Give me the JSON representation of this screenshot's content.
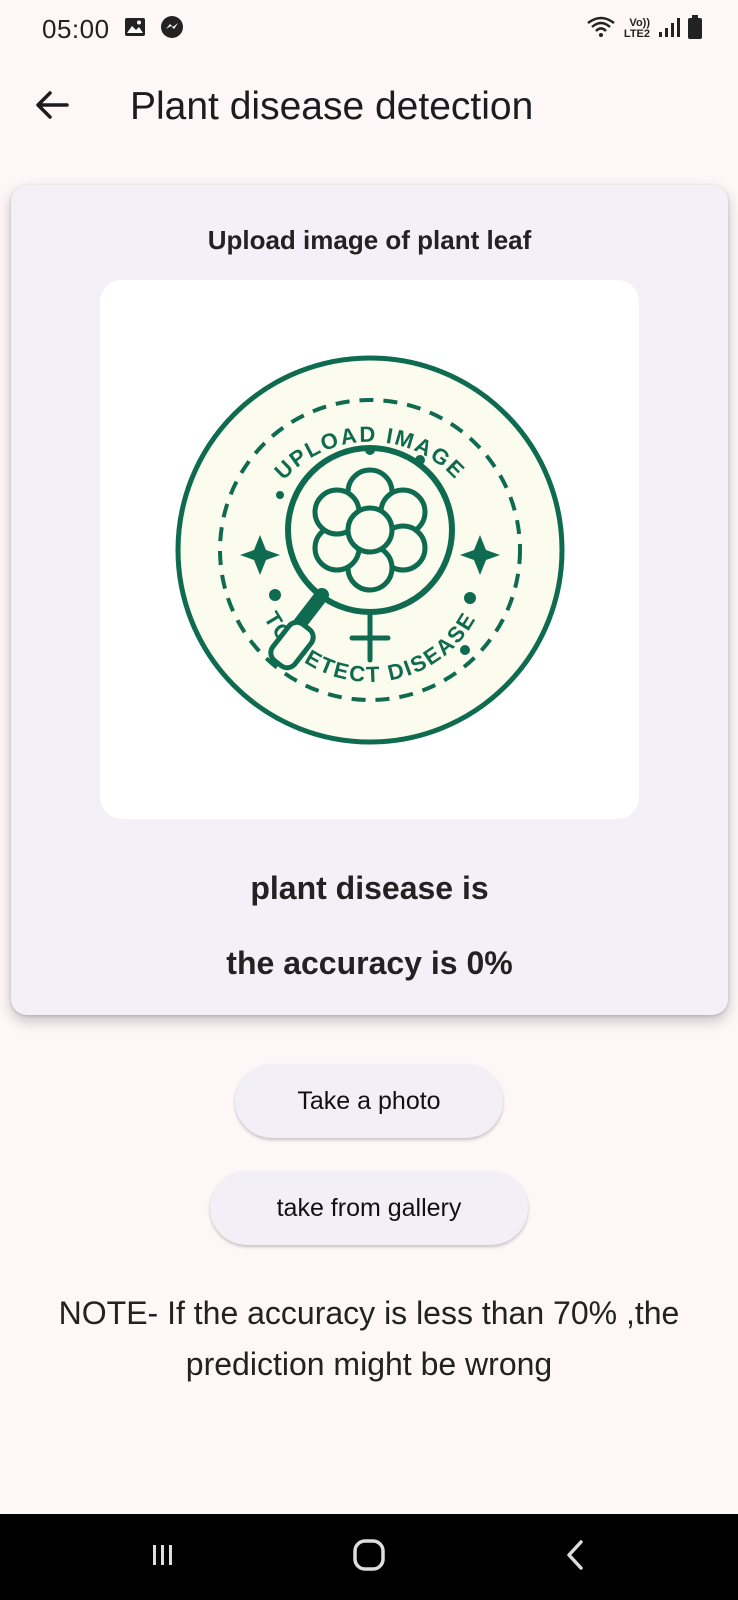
{
  "status_bar": {
    "time": "05:00",
    "lte_top": "Vo))",
    "lte_bottom": "LTE2",
    "icons": [
      "gallery-icon",
      "messenger-icon",
      "wifi-icon",
      "signal-icon",
      "battery-icon"
    ]
  },
  "app_bar": {
    "title": "Plant disease detection",
    "back_icon": "arrow-back-icon"
  },
  "card": {
    "heading": "Upload image of plant leaf",
    "placeholder_image": {
      "top_text": "UPLOAD IMAGE",
      "bottom_text": "TO DETECT DISEASE",
      "icon": "magnifier-flower-icon"
    },
    "disease_text": "plant disease is",
    "accuracy_text": "the accuracy is 0%"
  },
  "buttons": {
    "take_photo": "Take a photo",
    "gallery": "take from gallery"
  },
  "note": {
    "line1": "NOTE- If the accuracy is less than 70% ,the",
    "line2": "prediction might be wrong"
  },
  "nav_bar": {
    "icons": [
      "recents-icon",
      "home-icon",
      "back-nav-icon"
    ]
  },
  "colors": {
    "background": "#fdf7f8",
    "card": "#f3f1f7",
    "emblem_green": "#0e6b4f",
    "emblem_fill": "#fbfbee"
  }
}
